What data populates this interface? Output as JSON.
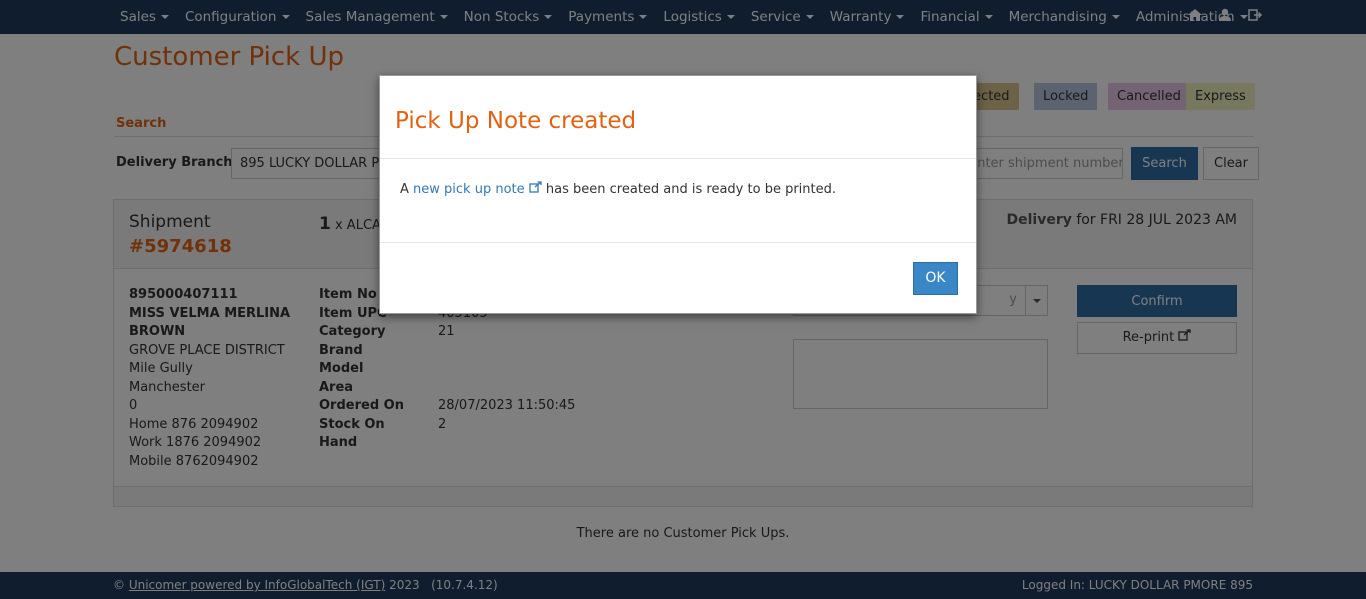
{
  "nav": {
    "menu": [
      "Sales",
      "Configuration",
      "Sales Management",
      "Non Stocks",
      "Payments",
      "Logistics",
      "Service",
      "Warranty",
      "Financial",
      "Merchandising",
      "Administration"
    ],
    "icons": [
      "home-icon",
      "user-icon",
      "logout-icon"
    ]
  },
  "page": {
    "title": "Customer Pick Up",
    "legend": {
      "rejected": "Rejected",
      "locked": "Locked",
      "cancelled": "Cancelled",
      "express": "Express"
    },
    "legend_colors": {
      "rejected": "#d9c58f",
      "locked": "#b6c4e0",
      "cancelled": "#e7c6e6",
      "express": "#eef0bc"
    }
  },
  "search": {
    "section_label": "Search",
    "delivery_branch_label": "Delivery Branch:",
    "delivery_branch_value": "895 LUCKY DOLLAR PMORE",
    "shipment_placeholder": "Enter shipment number",
    "search_button": "Search",
    "clear_button": "Clear"
  },
  "shipment": {
    "label": "Shipment",
    "number": "#5974618",
    "qty": "1",
    "qty_text": "x ALCATEL",
    "delivery_label": "Delivery",
    "delivery_text": "for FRI 28 JUL 2023 AM",
    "customer": {
      "account": "895000407111",
      "name_line1": "MISS VELMA MERLINA",
      "name_line2": "BROWN",
      "addr1": "GROVE PLACE DISTRICT",
      "addr2": "Mile Gully",
      "addr3": "Manchester",
      "addr4": "0",
      "home": "Home 876 2094902",
      "work": "Work 1876 2094902",
      "mobile": "Mobile 8762094902"
    },
    "field_labels": {
      "item_no": "Item No",
      "item_upc": "Item UPC",
      "category": "Category",
      "brand": "Brand",
      "model": "Model",
      "area": "Area",
      "ordered_on": "Ordered On",
      "stock_on": "Stock On",
      "hand": "Hand"
    },
    "field_values": {
      "item_upc": "405105",
      "category": "21",
      "ordered_on": "28/07/2023 11:50:45",
      "stock_on_hand": "2"
    },
    "select_value": "y",
    "confirm_button": "Confirm",
    "reprint_button": "Re-print"
  },
  "empty_message": "There are no Customer Pick Ups.",
  "footer": {
    "copyright_symbol": "©",
    "company_link": "Unicomer powered by InfoGlobalTech (IGT)",
    "year_version": "2023   (10.7.4.12)",
    "logged_in": "Logged In: LUCKY DOLLAR PMORE 895"
  },
  "modal": {
    "title": "Pick Up Note created",
    "body_prefix": "A",
    "body_link": "new pick up note",
    "body_suffix": "has been created and is ready to be printed.",
    "ok_button": "OK"
  }
}
